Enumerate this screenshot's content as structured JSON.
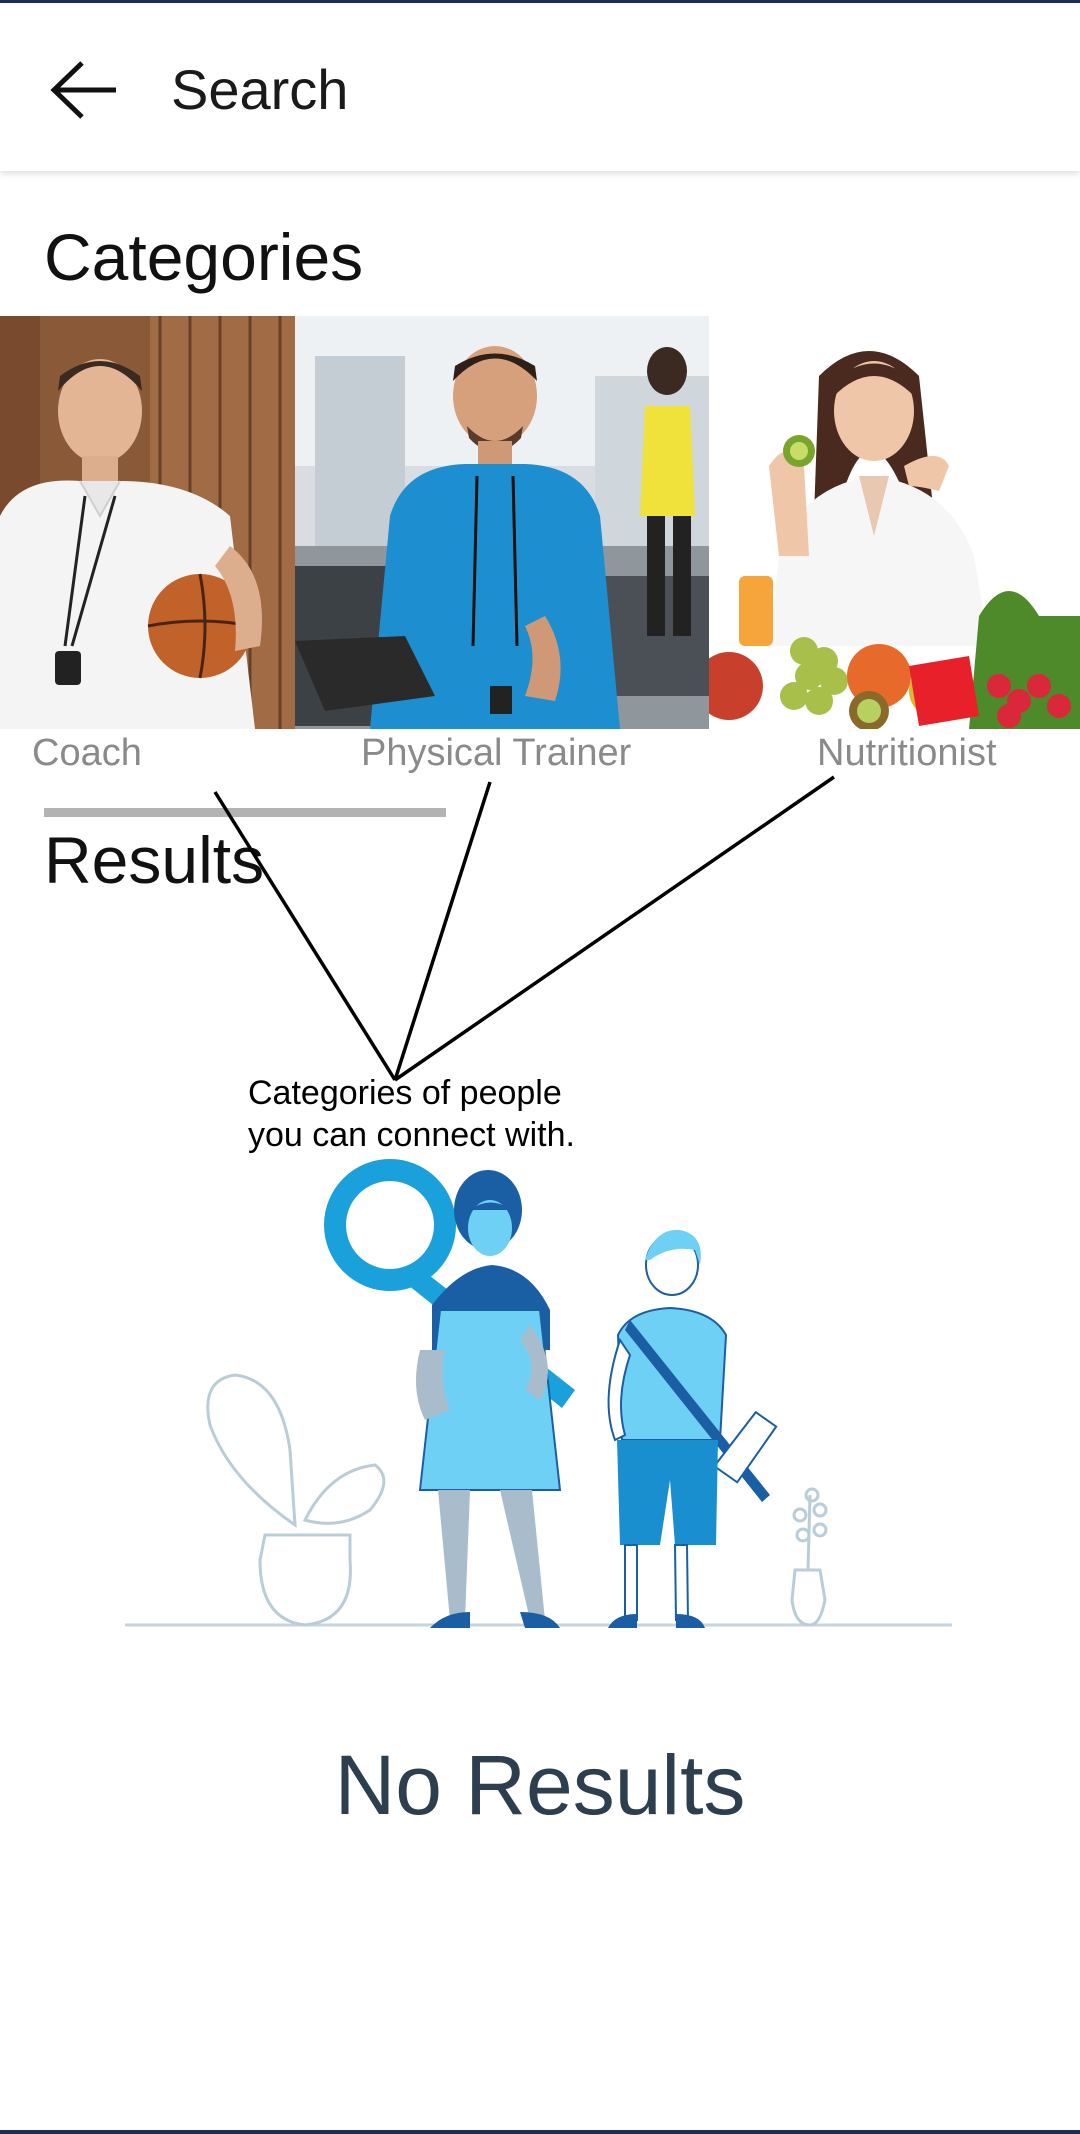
{
  "header": {
    "title": "Search",
    "back_icon": "arrow-left-icon"
  },
  "categories": {
    "title": "Categories",
    "items": [
      {
        "label": "Coach",
        "image": "coach-photo",
        "selected": true
      },
      {
        "label": "Physical Trainer",
        "image": "physical-trainer-photo",
        "selected": false
      },
      {
        "label": "Nutritionist",
        "image": "nutritionist-photo",
        "selected": false
      }
    ]
  },
  "results": {
    "title": "Results",
    "empty_illustration": "people-search-illustration",
    "empty_text": "No Results"
  },
  "annotation": {
    "line1": "Categories of people",
    "line2": "you can connect with."
  },
  "colors": {
    "status_bar": "#1b2d5b",
    "indicator": "#b3b3b3",
    "label_gray": "#8a8a8a",
    "no_results_text": "#2d3e4f",
    "illustration_light_blue": "#6fd0f5",
    "illustration_mid_blue": "#1a9bd7",
    "illustration_dark_blue": "#1a5fa3"
  }
}
